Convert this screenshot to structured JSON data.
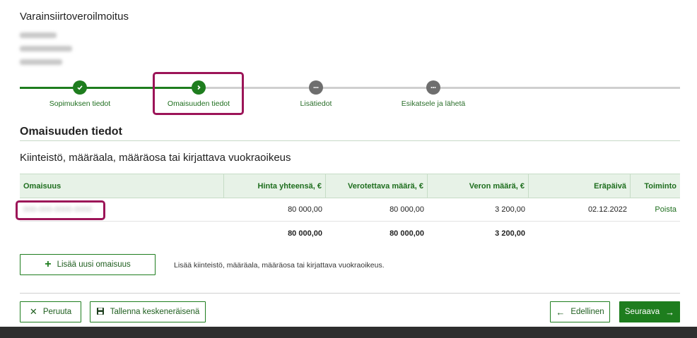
{
  "page": {
    "title": "Varainsiirtoveroilmoitus"
  },
  "stepper": {
    "steps": [
      {
        "label": "Sopimuksen tiedot",
        "state": "done",
        "icon": "check-icon"
      },
      {
        "label": "Omaisuuden tiedot",
        "state": "current",
        "icon": "chevron-right-icon"
      },
      {
        "label": "Lisätiedot",
        "state": "todo",
        "icon": "dots-icon"
      },
      {
        "label": "Esikatsele ja lähetä",
        "state": "todo",
        "icon": "dots-icon"
      }
    ]
  },
  "section": {
    "title": "Omaisuuden tiedot",
    "subtitle": "Kiinteistö, määräala, määräosa tai kirjattava vuokraoikeus"
  },
  "table": {
    "headers": [
      "Omaisuus",
      "Hinta yhteensä, €",
      "Verotettava määrä, €",
      "Veron määrä, €",
      "Eräpäivä",
      "Toiminto"
    ],
    "rows": [
      {
        "property": "000-000-0000-0000",
        "price": "80 000,00",
        "taxable": "80 000,00",
        "tax": "3 200,00",
        "due": "02.12.2022",
        "action": "Poista"
      }
    ],
    "totals": {
      "price": "80 000,00",
      "taxable": "80 000,00",
      "tax": "3 200,00"
    }
  },
  "actions": {
    "add_label": "Lisää uusi omaisuus",
    "add_help": "Lisää kiinteistö, määräala, määräosa tai kirjattava vuokraoikeus.",
    "cancel_label": "Peruuta",
    "save_label": "Tallenna keskeneräisenä",
    "prev_label": "Edellinen",
    "next_label": "Seuraava"
  },
  "colors": {
    "accent": "#1e7d1e",
    "highlight": "#9c1458",
    "header_bg": "#e7f2e7"
  }
}
